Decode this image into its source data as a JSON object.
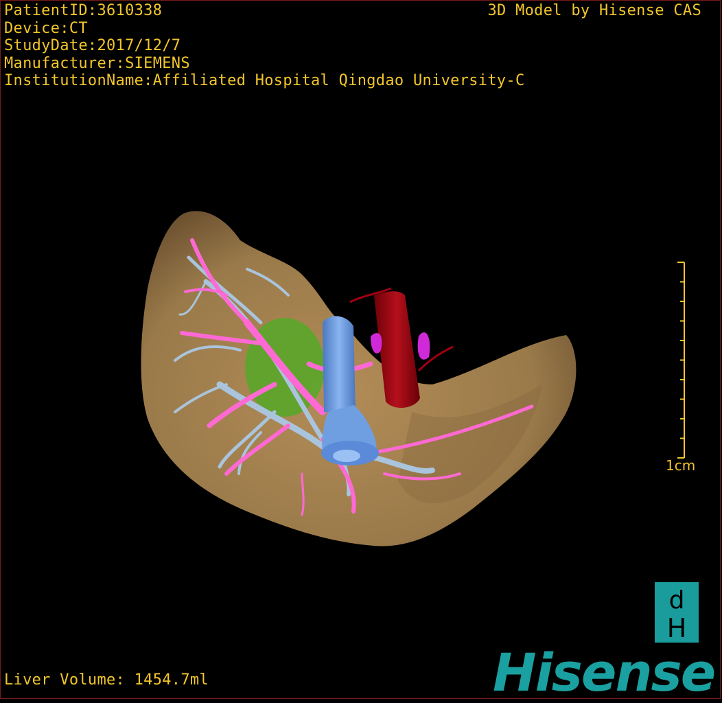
{
  "header": {
    "patient_id": "PatientID:3610338",
    "device": "Device:CT",
    "study_date": "StudyDate:2017/12/7",
    "manufacturer": "Manufacturer:SIEMENS",
    "institution": "InstitutionName:Affiliated Hospital Qingdao University-C"
  },
  "brand_label": "3D Model by Hisense CAS",
  "scale_bar": {
    "label": "1cm",
    "tick_count": 10
  },
  "footer": {
    "liver_volume": "Liver Volume: 1454.7ml"
  },
  "logo": {
    "text": "Hisense",
    "icon": "hisense-dh-icon"
  },
  "colors": {
    "overlay_text": "#f2c62a",
    "liver": "#a0804f",
    "portal_vein": "#ff69d4",
    "hepatic_vein": "#a9c4dc",
    "ivc": "#6f9fe0",
    "aorta": "#a00010",
    "tumor": "#5aa62a",
    "brand": "#1aa0a0"
  }
}
